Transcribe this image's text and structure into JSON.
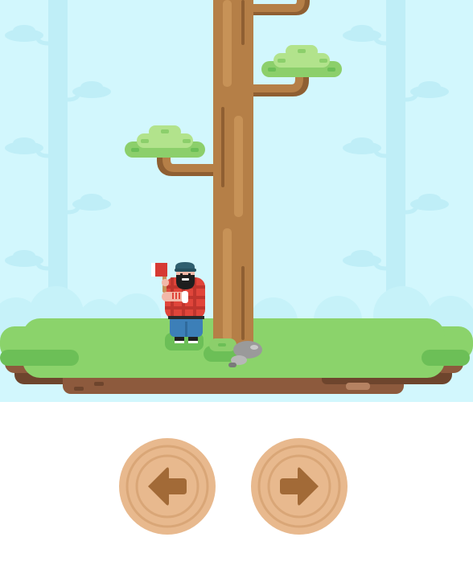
{
  "game": {
    "controls": {
      "left_icon": "arrow-left-icon",
      "right_icon": "arrow-right-icon"
    },
    "player_side": "left",
    "branches": [
      {
        "side": "right"
      },
      {
        "side": "right"
      },
      {
        "side": "left"
      }
    ],
    "colors": {
      "sky": "#d2f7fd",
      "background_trees": "#bfeef7",
      "hills": "#c6f2f9",
      "grass": "#8bd36b",
      "grass_dark": "#6cbf57",
      "dirt": "#8d5a3d",
      "trunk": "#b57f47",
      "trunk_light": "#c79257",
      "trunk_dark": "#8f5f32",
      "leaves": "#8ccf6b",
      "leaves_light": "#b2e38c",
      "shirt": "#e0453a",
      "jeans": "#3c7fb8",
      "axe_head": "#d63a33",
      "button_wood": "#e8b98e",
      "button_ring": "#d9a677",
      "arrow": "#a26a37"
    }
  }
}
